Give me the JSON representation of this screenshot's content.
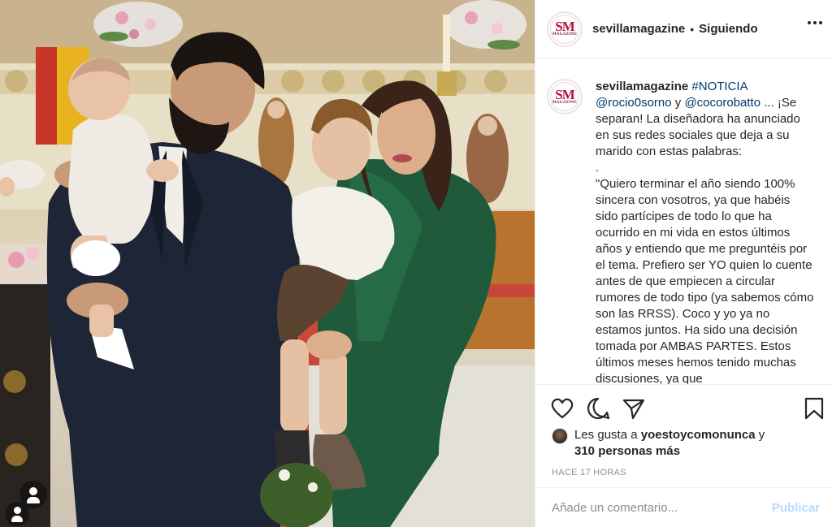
{
  "post": {
    "username": "sevillamagazine",
    "follow_separator": "•",
    "follow_status": "Siguiendo",
    "avatar": {
      "monogram": "SM",
      "subtitle": "MAGAZINE",
      "brand_color": "#b5113a"
    }
  },
  "caption": {
    "username": "sevillamagazine",
    "hashtag": "#NOTICIA",
    "mention1": "@rocio0sorno",
    "conj": "y",
    "mention2": "@cocorobatto",
    "headline": "... ¡Se separan! La diseñadora ha anunciado en sus redes sociales que deja a su marido con estas palabras:",
    "dot": ".",
    "quote": "\"Quiero terminar el año siendo 100% sincera con vosotros, ya que habéis sido partícipes de todo lo que ha ocurrido en mi vida en estos últimos años y entiendo que me preguntéis por el tema. Prefiero ser YO quien lo cuente antes de que empiecen a circular rumores de todo tipo (ya sabemos cómo son las RRSS). Coco y yo ya no estamos juntos. Ha sido una decisión tomada por AMBAS PARTES. Estos últimos meses hemos tenido muchas discusiones, ya que"
  },
  "actions": {
    "like_icon": "heart-icon",
    "comment_icon": "comment-icon",
    "share_icon": "paper-plane-icon",
    "save_icon": "bookmark-icon"
  },
  "likes": {
    "prefix": "Les gusta a",
    "user": "yoestoycomonunca",
    "conj": "y",
    "others": "310 personas más"
  },
  "timestamp": "HACE 17 HORAS",
  "comment": {
    "placeholder": "Añade un comentario...",
    "post_label": "Publicar"
  },
  "colors": {
    "link": "#00376b",
    "muted": "#8e8e8e",
    "post_disabled": "#b3dbff",
    "border": "#efefef"
  }
}
